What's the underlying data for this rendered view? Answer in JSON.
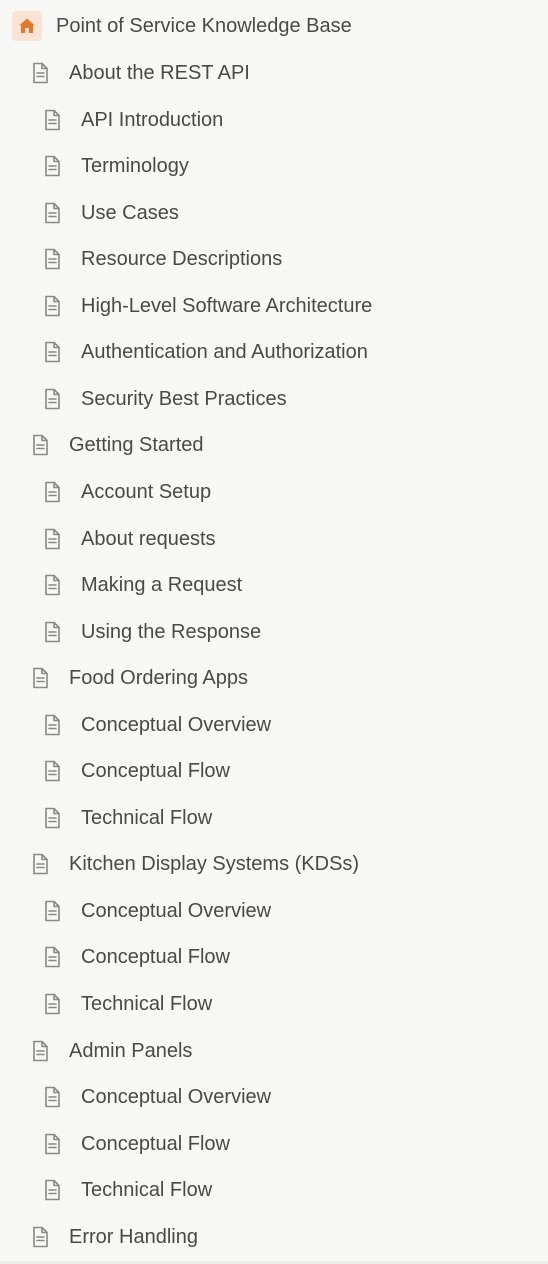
{
  "sidebar": {
    "root": {
      "label": "Point of Service Knowledge Base",
      "icon": "home-icon",
      "icon_color": "#e07a2f",
      "icon_bg": "#fbe4d5"
    },
    "items": [
      {
        "label": "About the REST API",
        "level": 1,
        "icon": "page-icon"
      },
      {
        "label": "API Introduction",
        "level": 2,
        "icon": "page-icon"
      },
      {
        "label": "Terminology",
        "level": 2,
        "icon": "page-icon"
      },
      {
        "label": "Use Cases",
        "level": 2,
        "icon": "page-icon"
      },
      {
        "label": "Resource Descriptions",
        "level": 2,
        "icon": "page-icon"
      },
      {
        "label": "High-Level Software Architecture",
        "level": 2,
        "icon": "page-icon"
      },
      {
        "label": "Authentication and Authorization",
        "level": 2,
        "icon": "page-icon"
      },
      {
        "label": "Security Best Practices",
        "level": 2,
        "icon": "page-icon"
      },
      {
        "label": "Getting Started",
        "level": 1,
        "icon": "page-icon"
      },
      {
        "label": "Account Setup",
        "level": 2,
        "icon": "page-icon"
      },
      {
        "label": "About requests",
        "level": 2,
        "icon": "page-icon"
      },
      {
        "label": "Making a Request",
        "level": 2,
        "icon": "page-icon"
      },
      {
        "label": "Using the Response",
        "level": 2,
        "icon": "page-icon"
      },
      {
        "label": "Food Ordering Apps",
        "level": 1,
        "icon": "page-icon"
      },
      {
        "label": "Conceptual Overview",
        "level": 2,
        "icon": "page-icon"
      },
      {
        "label": "Conceptual Flow",
        "level": 2,
        "icon": "page-icon"
      },
      {
        "label": "Technical Flow",
        "level": 2,
        "icon": "page-icon"
      },
      {
        "label": "Kitchen Display Systems (KDSs)",
        "level": 1,
        "icon": "page-icon"
      },
      {
        "label": "Conceptual Overview",
        "level": 2,
        "icon": "page-icon"
      },
      {
        "label": "Conceptual Flow",
        "level": 2,
        "icon": "page-icon"
      },
      {
        "label": "Technical Flow",
        "level": 2,
        "icon": "page-icon"
      },
      {
        "label": "Admin Panels",
        "level": 1,
        "icon": "page-icon"
      },
      {
        "label": "Conceptual Overview",
        "level": 2,
        "icon": "page-icon"
      },
      {
        "label": "Conceptual Flow",
        "level": 2,
        "icon": "page-icon"
      },
      {
        "label": "Technical Flow",
        "level": 2,
        "icon": "page-icon"
      },
      {
        "label": "Error Handling",
        "level": 1,
        "icon": "page-icon"
      }
    ]
  },
  "colors": {
    "background": "#f7f7f5",
    "text": "#4a4945",
    "icon_stroke": "#8a8984"
  }
}
